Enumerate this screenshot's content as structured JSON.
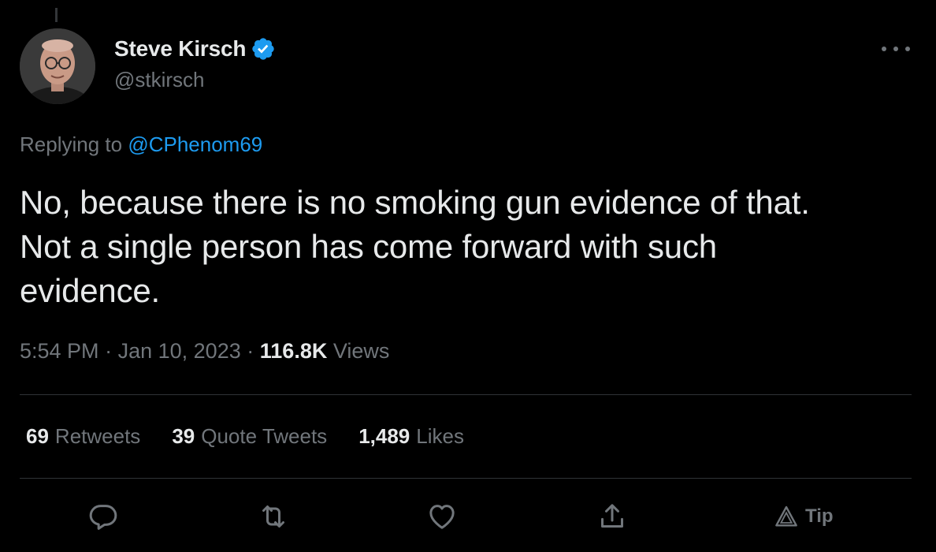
{
  "tweet": {
    "author": {
      "display_name": "Steve Kirsch",
      "handle": "@stkirsch",
      "verified": true
    },
    "replying": {
      "prefix": "Replying to",
      "mention": "@CPhenom69"
    },
    "text_lines": [
      "No, because there is no smoking gun evidence of that.",
      "Not a single person has come forward with such",
      "evidence."
    ],
    "meta": {
      "time": "5:54 PM",
      "separator": "·",
      "date": "Jan 10, 2023",
      "views_count": "116.8K",
      "views_label": "Views"
    },
    "stats": [
      {
        "count": "69",
        "label": "Retweets"
      },
      {
        "count": "39",
        "label": "Quote Tweets"
      },
      {
        "count": "1,489",
        "label": "Likes"
      }
    ],
    "actions": {
      "reply_icon": "reply-icon",
      "retweet_icon": "retweet-icon",
      "like_icon": "heart-icon",
      "share_icon": "share-icon",
      "tip_icon": "tip-icon",
      "tip_label": "Tip"
    }
  },
  "colors": {
    "background": "#000000",
    "primary_text": "#e7e9ea",
    "secondary_text": "#71767b",
    "accent": "#1d9bf0",
    "divider": "#2f3336"
  }
}
